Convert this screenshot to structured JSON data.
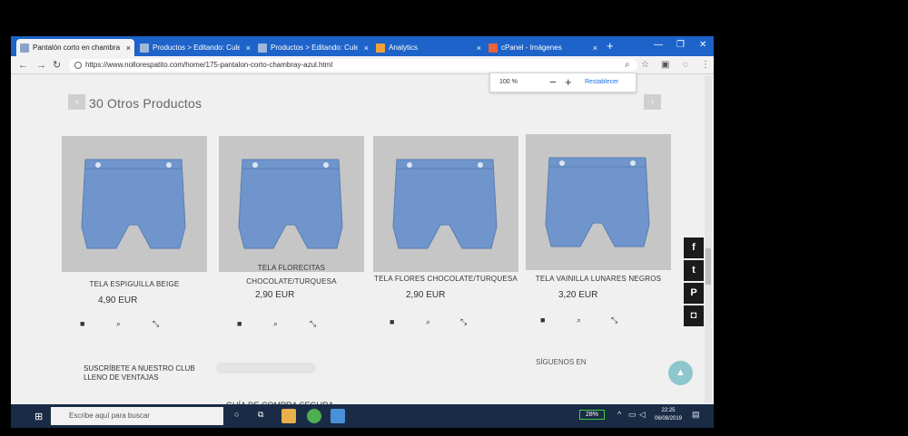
{
  "browser": {
    "tabs": [
      {
        "title": "Pantalón corto en chambray a",
        "active": true,
        "favicon_color": "#8aa3c7"
      },
      {
        "title": "Productos > Editando: Culetín",
        "active": false,
        "favicon_color": "#9fb7d9"
      },
      {
        "title": "Productos > Editando: Culetín",
        "active": false,
        "favicon_color": "#9fb7d9"
      },
      {
        "title": "Analytics",
        "active": false,
        "favicon_color": "#f2a33a"
      },
      {
        "title": "cPanel - Imágenes",
        "active": false,
        "favicon_color": "#e8643b"
      }
    ],
    "close_glyph": "×",
    "newtab_glyph": "+",
    "url": "https://www.nollorespatito.com/home/175-pantalon-corto-chambray-azul.html",
    "zoom": {
      "value": "100 %",
      "minus": "−",
      "plus": "+",
      "reset_label": "Restablecer"
    },
    "nav_icons": [
      "back-icon",
      "forward-icon",
      "reload-icon"
    ],
    "toolbar_icons": [
      "zoom-icon",
      "star-icon",
      "extension-icon",
      "menu-icon"
    ]
  },
  "page": {
    "section_title": "30 Otros Productos",
    "products": [
      {
        "name": "TELA ESPIGUILLA BEIGE",
        "price": "4,90 EUR"
      },
      {
        "name": "TELA FLORECITAS CHOCOLATE/TURQUESA",
        "price": "2,90 EUR"
      },
      {
        "name": "TELA FLORES CHOCOLATE/TURQUESA",
        "price": "2,90 EUR"
      },
      {
        "name": "TELA VAINILLA LUNARES NEGROS",
        "price": "3,20 EUR"
      }
    ],
    "product_actions": [
      "cart-icon",
      "search-icon",
      "expand-icon"
    ],
    "newsletter": "SUSCRÍBETE A NUESTRO CLUB LLENO DE VENTAJAS",
    "follow": "SÍGUENOS EN",
    "guide": "GUÍA DE COMPRA SEGURA",
    "social": [
      {
        "icon": "facebook-icon",
        "glyph": "f"
      },
      {
        "icon": "twitter-icon",
        "glyph": "t"
      },
      {
        "icon": "pinterest-icon",
        "glyph": "P"
      },
      {
        "icon": "instagram-icon",
        "glyph": "◘"
      }
    ],
    "accent_color": "#8ec6cd"
  },
  "taskbar": {
    "search_placeholder": "Escribe aquí para buscar",
    "battery": "28%",
    "time": "22:25",
    "date": "06/08/2019"
  }
}
